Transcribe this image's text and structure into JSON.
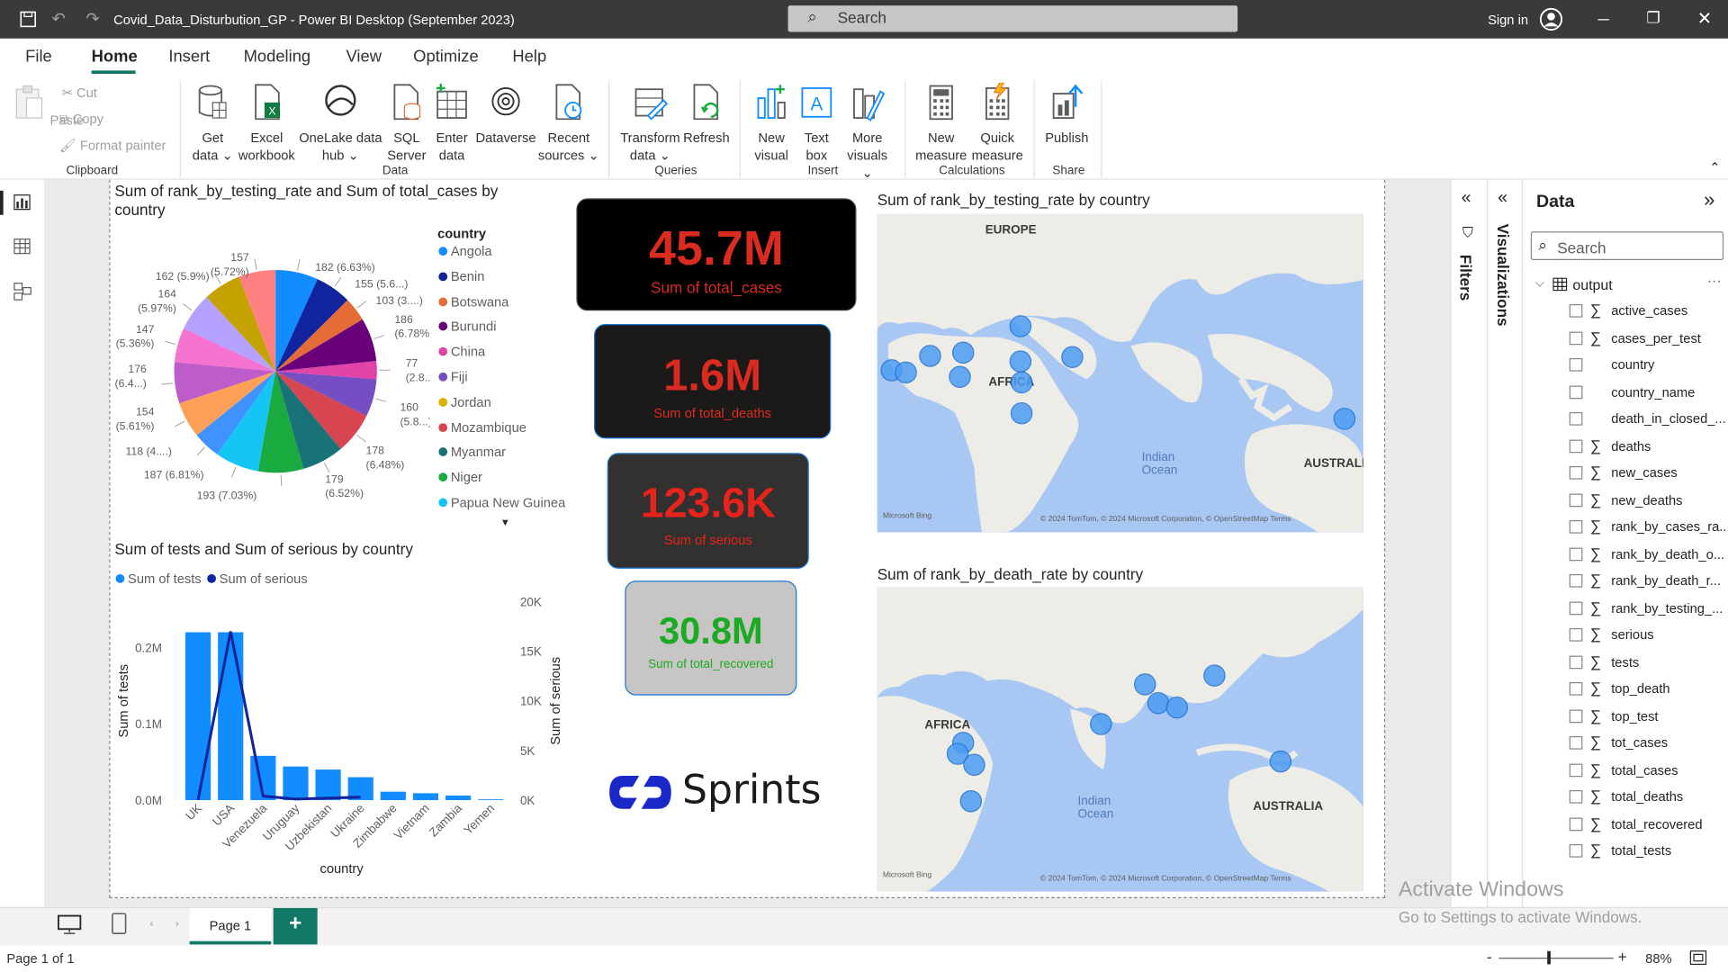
{
  "titlebar": {
    "filename": "Covid_Data_Disturbution_GP - Power BI Desktop (September 2023)",
    "search_placeholder": "Search",
    "signin": "Sign in"
  },
  "menu": [
    "File",
    "Home",
    "Insert",
    "Modeling",
    "View",
    "Optimize",
    "Help"
  ],
  "ribbon": {
    "clipboard": {
      "paste": "Paste",
      "cut": "Cut",
      "copy": "Copy",
      "format_painter": "Format painter",
      "group": "Clipboard"
    },
    "data": {
      "get_data": [
        "Get",
        "data"
      ],
      "excel": [
        "Excel",
        "workbook"
      ],
      "onelake": [
        "OneLake data",
        "hub"
      ],
      "sql": [
        "SQL",
        "Server"
      ],
      "enter": [
        "Enter",
        "data"
      ],
      "dataverse": "Dataverse",
      "recent": [
        "Recent",
        "sources"
      ],
      "group": "Data"
    },
    "queries": {
      "transform": [
        "Transform",
        "data"
      ],
      "refresh": "Refresh",
      "group": "Queries"
    },
    "insert": {
      "new_visual": [
        "New",
        "visual"
      ],
      "text_box": [
        "Text",
        "box"
      ],
      "more_visuals": [
        "More",
        "visuals"
      ],
      "group": "Insert"
    },
    "calculations": {
      "new_measure": [
        "New",
        "measure"
      ],
      "quick_measure": [
        "Quick",
        "measure"
      ],
      "group": "Calculations"
    },
    "share": {
      "publish": "Publish",
      "group": "Share"
    }
  },
  "pie": {
    "title_l1": "Sum of rank_by_testing_rate and Sum of total_cases by",
    "title_l2": "country",
    "legend_title": "country",
    "legend": [
      {
        "name": "Angola",
        "color": "#118dff"
      },
      {
        "name": "Benin",
        "color": "#12239e"
      },
      {
        "name": "Botswana",
        "color": "#e66c37"
      },
      {
        "name": "Burundi",
        "color": "#6b007b"
      },
      {
        "name": "China",
        "color": "#e044a7"
      },
      {
        "name": "Fiji",
        "color": "#744ec2"
      },
      {
        "name": "Jordan",
        "color": "#d9b300"
      },
      {
        "name": "Mozambique",
        "color": "#d64550"
      },
      {
        "name": "Myanmar",
        "color": "#197278"
      },
      {
        "name": "Niger",
        "color": "#1aab40"
      },
      {
        "name": "Papua New Guinea",
        "color": "#15c6f4"
      }
    ],
    "labels": [
      {
        "text": "182 (6.63%)"
      },
      {
        "text": "155 (5.6...)"
      },
      {
        "text": "103 (3....)"
      },
      {
        "text": "186"
      },
      {
        "text": "(6.78%)"
      },
      {
        "text": "77"
      },
      {
        "text": "(2.8...)"
      },
      {
        "text": "160"
      },
      {
        "text": "(5.8...)"
      },
      {
        "text": "178"
      },
      {
        "text": "(6.48%)"
      },
      {
        "text": "179"
      },
      {
        "text": "(6.52%)"
      },
      {
        "text": "193 (7.03%)"
      },
      {
        "text": "187 (6.81%)"
      },
      {
        "text": "118 (4....)"
      },
      {
        "text": "154"
      },
      {
        "text": "(5.61%)"
      },
      {
        "text": "176"
      },
      {
        "text": "(6.4...)"
      },
      {
        "text": "147"
      },
      {
        "text": "(5.36%)"
      },
      {
        "text": "164"
      },
      {
        "text": "(5.97%)"
      },
      {
        "text": "162 (5.9%)"
      },
      {
        "text": "157"
      },
      {
        "text": "(5.72%)"
      }
    ]
  },
  "cards": [
    {
      "value": "45.7M",
      "label": "Sum of total_cases"
    },
    {
      "value": "1.6M",
      "label": "Sum of total_deaths"
    },
    {
      "value": "123.6K",
      "label": "Sum of serious"
    },
    {
      "value": "30.8M",
      "label": "Sum of total_recovered"
    }
  ],
  "map1": {
    "title": "Sum of rank_by_testing_rate by country",
    "labels": [
      "EUROPE",
      "AFRICA",
      "Indian",
      "Ocean",
      "AUSTRALIA"
    ],
    "credit": "Microsoft Bing",
    "copyright": "© 2024 TomTom, © 2024 Microsoft Corporation, © OpenStreetMap  Terms"
  },
  "map2": {
    "title": "Sum of rank_by_death_rate by country",
    "labels": [
      "AFRICA",
      "Indian",
      "Ocean",
      "AUSTRALIA"
    ],
    "credit": "Microsoft Bing",
    "copyright": "© 2024 TomTom, © 2024 Microsoft Corporation, © OpenStreetMap  Terms"
  },
  "chart_data": [
    {
      "type": "pie",
      "title": "Sum of rank_by_testing_rate and Sum of total_cases by country",
      "legend_title": "country",
      "values": [
        182,
        155,
        103,
        186,
        77,
        160,
        178,
        179,
        193,
        187,
        118,
        154,
        176,
        147,
        164,
        162,
        157
      ],
      "percent_labels": [
        "6.63%",
        "5.6...",
        "3....",
        "6.78%",
        "2.8...",
        "5.8...",
        "6.48%",
        "6.52%",
        "7.03%",
        "6.81%",
        "4....",
        "5.61%",
        "6.4...",
        "5.36%",
        "5.97%",
        "5.9%",
        "5.72%"
      ],
      "colors": [
        "#118dff",
        "#12239e",
        "#e66c37",
        "#6b007b",
        "#e044a7",
        "#744ec2",
        "#d64550",
        "#197278",
        "#1aab40",
        "#15c6f4",
        "#4092ff",
        "#ffa058",
        "#be5dc9",
        "#f472d0",
        "#b5a1ff",
        "#c4a200",
        "#ff8080"
      ]
    },
    {
      "type": "bar",
      "title": "Sum of tests and Sum of serious by country",
      "xlabel": "country",
      "ylabel": "Sum of tests",
      "y2label": "Sum of serious",
      "categories": [
        "UK",
        "USA",
        "Venezuela",
        "Uruguay",
        "Uzbekistan",
        "Ukraine",
        "Zimbabwe",
        "Vietnam",
        "Zambia",
        "Yemen"
      ],
      "series": [
        {
          "name": "Sum of tests",
          "type": "bar",
          "values": [
            0.22,
            0.22,
            0.058,
            0.044,
            0.04,
            0.03,
            0.011,
            0.009,
            0.006,
            0.001
          ],
          "color": "#118dff"
        },
        {
          "name": "Sum of serious",
          "type": "line",
          "values": [
            0,
            17000,
            400,
            100,
            200,
            300,
            0,
            0,
            0,
            0
          ],
          "color": "#12239e"
        }
      ],
      "y_ticks": [
        "0.0M",
        "0.1M",
        "0.2M"
      ],
      "y2_ticks": [
        "0K",
        "5K",
        "10K",
        "15K",
        "20K"
      ],
      "ylim": [
        0,
        0.26
      ],
      "y2lim": [
        0,
        20000
      ]
    }
  ],
  "data_pane": {
    "title": "Data",
    "search": "Search",
    "table": "output",
    "fields": [
      {
        "name": "active_cases",
        "sigma": true
      },
      {
        "name": "cases_per_test",
        "sigma": true
      },
      {
        "name": "country",
        "sigma": false
      },
      {
        "name": "country_name",
        "sigma": false
      },
      {
        "name": "death_in_closed_...",
        "sigma": false
      },
      {
        "name": "deaths",
        "sigma": true
      },
      {
        "name": "new_cases",
        "sigma": true
      },
      {
        "name": "new_deaths",
        "sigma": true
      },
      {
        "name": "rank_by_cases_ra...",
        "sigma": true
      },
      {
        "name": "rank_by_death_o...",
        "sigma": true
      },
      {
        "name": "rank_by_death_r...",
        "sigma": true
      },
      {
        "name": "rank_by_testing_...",
        "sigma": true
      },
      {
        "name": "serious",
        "sigma": true
      },
      {
        "name": "tests",
        "sigma": true
      },
      {
        "name": "top_death",
        "sigma": true
      },
      {
        "name": "top_test",
        "sigma": true
      },
      {
        "name": "tot_cases",
        "sigma": true
      },
      {
        "name": "total_cases",
        "sigma": true
      },
      {
        "name": "total_deaths",
        "sigma": true
      },
      {
        "name": "total_recovered",
        "sigma": true
      },
      {
        "name": "total_tests",
        "sigma": true
      }
    ]
  },
  "panes": {
    "filters": "Filters",
    "visualizations": "Visualizations"
  },
  "logo_text": "Sprints",
  "page_tab": "Page 1",
  "status": {
    "page": "Page 1 of 1",
    "zoom": "88%"
  },
  "watermark": {
    "l1": "Activate Windows",
    "l2": "Go to Settings to activate Windows."
  }
}
